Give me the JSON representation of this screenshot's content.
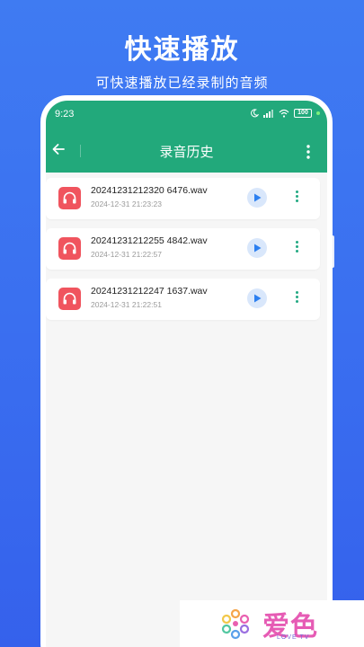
{
  "promo": {
    "title": "快速播放",
    "subtitle": "可快速播放已经录制的音频"
  },
  "status_bar": {
    "time": "9:23",
    "battery": "100"
  },
  "header": {
    "title": "录音历史",
    "accent_color": "#22a97b"
  },
  "recordings": [
    {
      "name": "20241231212320 6476.wav",
      "date": "2024-12-31 21:23:23"
    },
    {
      "name": "20241231212255 4842.wav",
      "date": "2024-12-31 21:22:57"
    },
    {
      "name": "20241231212247 1637.wav",
      "date": "2024-12-31 21:22:51"
    }
  ],
  "icons": {
    "back": "arrow-left-icon",
    "menu": "more-vertical-icon",
    "thumb": "headphones-icon",
    "play": "play-icon"
  },
  "watermark": {
    "text": "爱色",
    "sub": "LOVE TV"
  }
}
